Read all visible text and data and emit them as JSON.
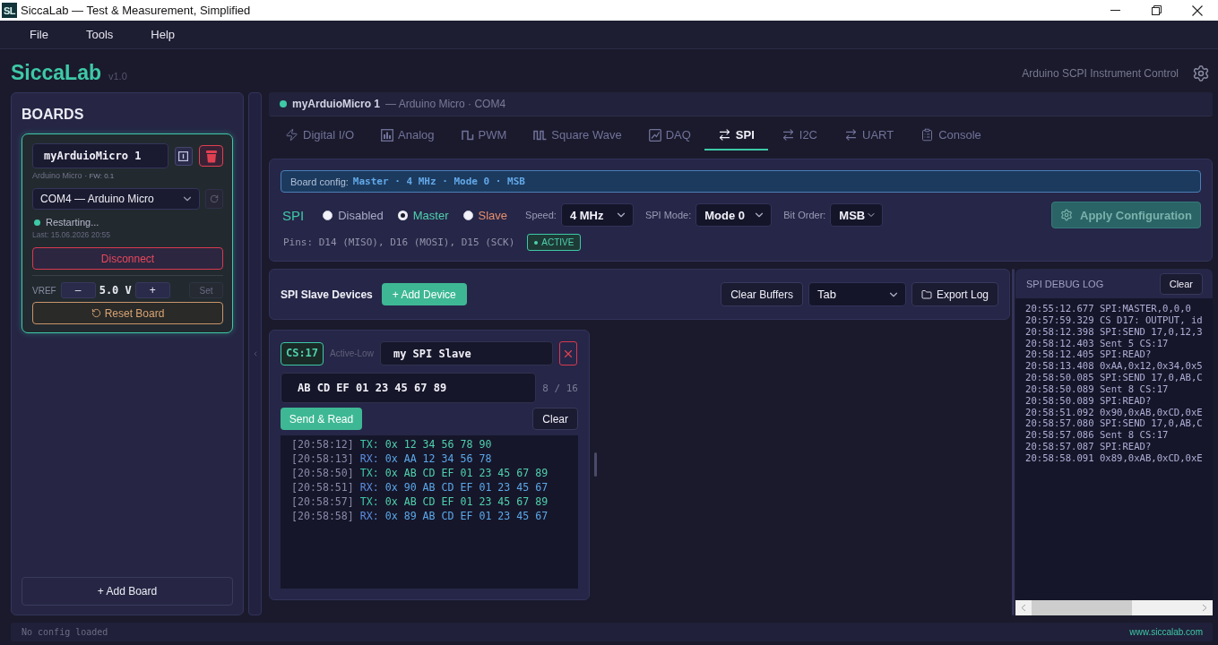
{
  "window": {
    "app_icon": "SL",
    "title": "SiccaLab — Test & Measurement, Simplified"
  },
  "menu": [
    {
      "label": "File"
    },
    {
      "label": "Tools"
    },
    {
      "label": "Help"
    }
  ],
  "header": {
    "brand": "SiccaLab",
    "version": "v1.0",
    "subtitle": "Arduino SCPI Instrument Control"
  },
  "sidebar": {
    "title": "BOARDS",
    "boards": [
      {
        "name": "myArduioMicro 1",
        "selected": true,
        "model": "Arduino Micro",
        "firmware": "· FW: 0.1",
        "port": "COM4 — Arduino Micro",
        "connected": true,
        "status": "Restarting...",
        "last_seen": "Last: 15.06.2026 20:55",
        "disconnect_button": "Disconnect",
        "vref": {
          "label": "VREF",
          "decrement": "–",
          "value": "5.0 V",
          "increment": "+",
          "set_button": "Set"
        },
        "reset_button": "Reset Board"
      }
    ],
    "add_button": "+ Add Board"
  },
  "device_bar": {
    "connected": true,
    "name": "myArduioMicro 1",
    "detail": "— Arduino Micro · COM4"
  },
  "tabs": [
    {
      "label": "Digital I/O",
      "kind": "digital",
      "selected": false
    },
    {
      "label": "Analog",
      "kind": "analog",
      "selected": false
    },
    {
      "label": "PWM",
      "kind": "pwm",
      "selected": false
    },
    {
      "label": "Square Wave",
      "kind": "wave",
      "selected": false
    },
    {
      "label": "DAQ",
      "kind": "daq",
      "selected": false
    },
    {
      "label": "SPI",
      "kind": "bus",
      "selected": true
    },
    {
      "label": "I2C",
      "kind": "bus",
      "selected": false
    },
    {
      "label": "UART",
      "kind": "bus",
      "selected": false
    },
    {
      "label": "Console",
      "kind": "console",
      "selected": false
    }
  ],
  "spi_config": {
    "banner": {
      "label": "Board config:",
      "value": "Master · 4 MHz · Mode 0 · MSB"
    },
    "title": "SPI",
    "modes": [
      {
        "label": "Disabled",
        "selected": false,
        "color": "#a9a9c6"
      },
      {
        "label": "Master",
        "selected": true,
        "color": "#4fd1ae"
      },
      {
        "label": "Slave",
        "selected": false,
        "color": "#e8906c"
      }
    ],
    "speed": {
      "label": "Speed:",
      "value": "4 MHz"
    },
    "spi_mode": {
      "label": "SPI Mode:",
      "value": "Mode 0"
    },
    "bit_order": {
      "label": "Bit Order:",
      "value": "MSB"
    },
    "apply_button": {
      "label": "Apply Configuration",
      "disabled": true
    },
    "pins": "Pins: D14 (MISO), D16 (MOSI), D15 (SCK)",
    "status": {
      "label": "ACTIVE",
      "active": true
    }
  },
  "slave_devices": {
    "title": "SPI Slave Devices",
    "add_button": "+ Add Device",
    "clear_button": "Clear Buffers",
    "format": "Tab",
    "export_button": "Export Log",
    "devices": [
      {
        "cs": "CS:17",
        "polarity": "Active-Low",
        "name": "my SPI Slave",
        "data": "AB CD EF 01 23 45 67 89",
        "count": "8 / 16",
        "send_button": "Send & Read",
        "clear_button": "Clear",
        "log": [
          {
            "kind": "tx",
            "time": "[20:58:12]",
            "direction": "TX:",
            "bytes": "0x 12 34 56 78 90"
          },
          {
            "kind": "rx",
            "time": "[20:58:13]",
            "direction": "RX:",
            "bytes": "0x AA 12 34 56 78"
          },
          {
            "kind": "tx",
            "time": "[20:58:50]",
            "direction": "TX:",
            "bytes": "0x AB CD EF 01 23 45 67 89"
          },
          {
            "kind": "rx",
            "time": "[20:58:51]",
            "direction": "RX:",
            "bytes": "0x 90 AB CD EF 01 23 45 67"
          },
          {
            "kind": "tx",
            "time": "[20:58:57]",
            "direction": "TX:",
            "bytes": "0x AB CD EF 01 23 45 67 89"
          },
          {
            "kind": "rx",
            "time": "[20:58:58]",
            "direction": "RX:",
            "bytes": "0x 89 AB CD EF 01 23 45 67"
          }
        ]
      }
    ]
  },
  "debug_log": {
    "title": "SPI DEBUG LOG",
    "clear_button": "Clear",
    "lines": [
      "20:55:12.677 SPI:MASTER,0,0,0",
      "20:57:59.329 CS D17: OUTPUT, id",
      "20:58:12.398 SPI:SEND 17,0,12,3",
      "20:58:12.403 Sent 5 CS:17",
      "20:58:12.405 SPI:READ?",
      "20:58:13.408 0xAA,0x12,0x34,0x5",
      "20:58:50.085 SPI:SEND 17,0,AB,C",
      "20:58:50.089 Sent 8 CS:17",
      "20:58:50.089 SPI:READ?",
      "20:58:51.092 0x90,0xAB,0xCD,0xE",
      "20:58:57.080 SPI:SEND 17,0,AB,C",
      "20:58:57.086 Sent 8 CS:17",
      "20:58:57.087 SPI:READ?",
      "20:58:58.091 0x89,0xAB,0xCD,0xE"
    ]
  },
  "status_bar": {
    "message": "No config loaded",
    "link": "www.siccalab.com"
  }
}
